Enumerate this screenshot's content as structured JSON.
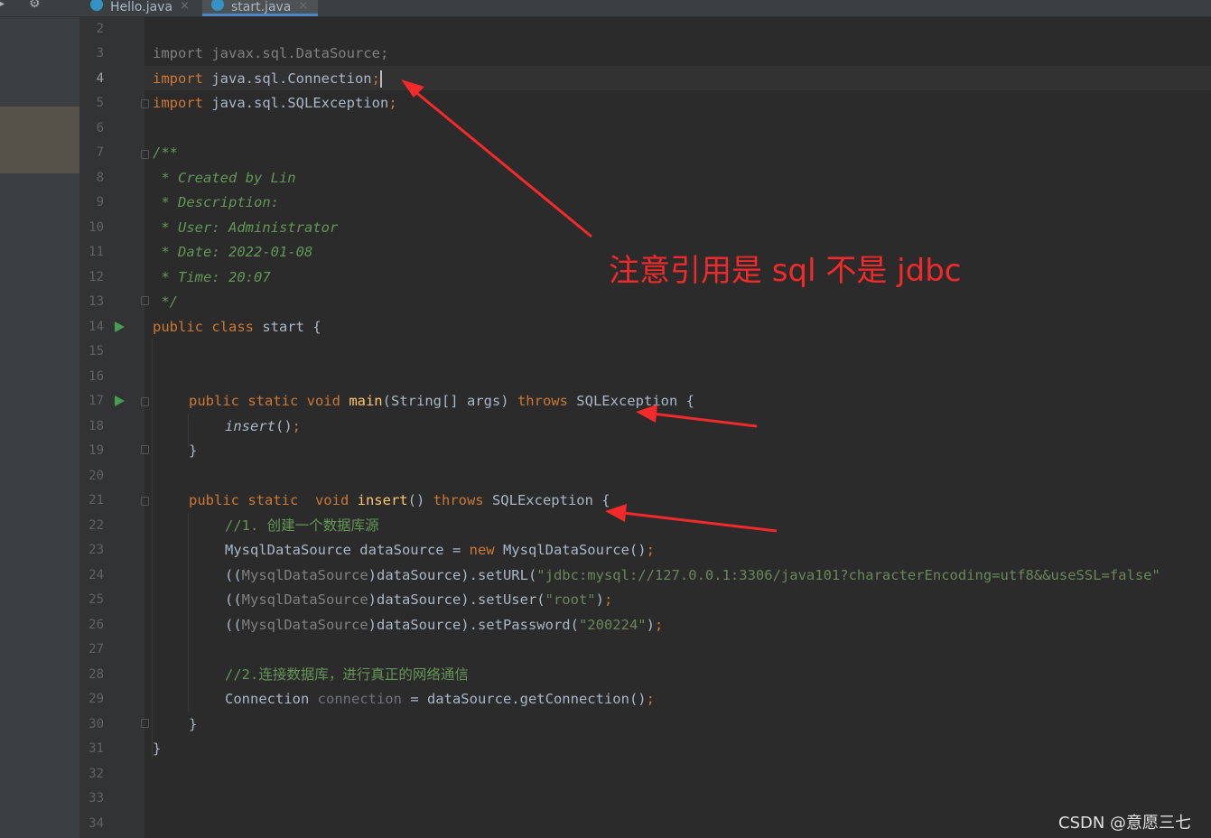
{
  "tabs": [
    {
      "label": "Hello.java",
      "close": "×",
      "active": false
    },
    {
      "label": "start.java",
      "close": "×",
      "active": true
    }
  ],
  "toolbar": {
    "settings_icon": "gear-icon",
    "minimize_icon": "minimize-icon"
  },
  "gutter": {
    "line_numbers": [
      "2",
      "3",
      "4",
      "5",
      "6",
      "7",
      "8",
      "9",
      "10",
      "11",
      "12",
      "13",
      "14",
      "15",
      "16",
      "17",
      "18",
      "19",
      "20",
      "21",
      "22",
      "23",
      "24",
      "25",
      "26",
      "27",
      "28",
      "29",
      "30",
      "31",
      "32",
      "33",
      "34"
    ],
    "active_line": "4"
  },
  "code": {
    "l3_kw": "import",
    "l3_rest": " javax.sql.DataSource;",
    "l4_kw": "import",
    "l4_rest": " java.sql.Connection",
    "l4_semi": ";",
    "l5_kw": "import",
    "l5_rest": " java.sql.SQLException",
    "l5_semi": ";",
    "l7": "/**",
    "l8": " * Created by Lin",
    "l9": " * Description:",
    "l10": " * User: Administrator",
    "l11": " * Date: 2022-01-08",
    "l12": " * Time: 20:07",
    "l13": " */",
    "l14_kw": "public class",
    "l14_rest": " start {",
    "l17_kw1": "public static void",
    "l17_fn": " main",
    "l17_mid": "(String[] args) ",
    "l17_kw2": "throws",
    "l17_rest": " SQLException {",
    "l18_it": "insert",
    "l18_rest": "()",
    "l18_semi": ";",
    "l19": "}",
    "l21_kw1": "public static  void",
    "l21_fn": " insert",
    "l21_mid": "() ",
    "l21_kw2": "throws",
    "l21_rest": " SQLException {",
    "l22": "//1. 创建一个数据库源",
    "l23_a": "MysqlDataSource dataSource = ",
    "l23_kw": "new",
    "l23_b": " MysqlDataSource()",
    "l23_semi": ";",
    "l24_a": "((",
    "l24_cast": "MysqlDataSource",
    "l24_b": ")dataSource).setURL(",
    "l24_str": "\"jdbc:mysql://127.0.0.1:3306/java101?characterEncoding=utf8&&useSSL=false\"",
    "l25_a": "((",
    "l25_cast": "MysqlDataSource",
    "l25_b": ")dataSource).setUser(",
    "l25_str": "\"root\"",
    "l25_c": ")",
    "l25_semi": ";",
    "l26_a": "((",
    "l26_cast": "MysqlDataSource",
    "l26_b": ")dataSource).setPassword(",
    "l26_str": "\"200224\"",
    "l26_c": ")",
    "l26_semi": ";",
    "l28": "//2.连接数据库，进行真正的网络通信",
    "l29_a": "Connection ",
    "l29_unused": "connection",
    "l29_b": " = dataSource.getConnection()",
    "l29_semi": ";",
    "l30": "}",
    "l31": "}"
  },
  "annotation": {
    "text": "注意引用是 sql 不是 jdbc",
    "color": "#f22a2a"
  },
  "watermark": "CSDN @意愿三七",
  "colors": {
    "background": "#2b2b2b",
    "keyword": "#cc7832",
    "string": "#6a8759",
    "comment": "#629755",
    "text": "#a9b7c6"
  }
}
